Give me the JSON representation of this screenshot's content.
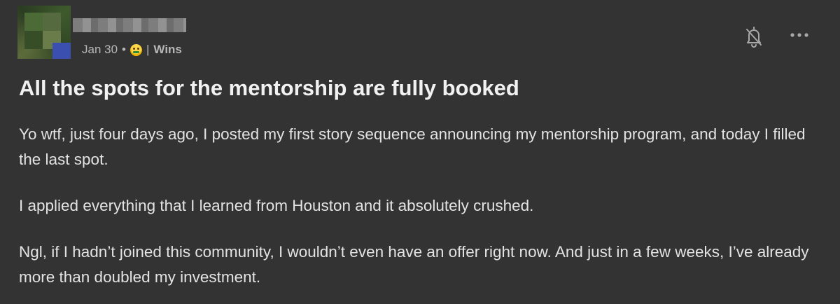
{
  "post": {
    "date": "Jan 30",
    "separator": "•",
    "emoji_icon": "money-mouth-face-emoji-icon",
    "category_prefix": "|",
    "category": "Wins",
    "title": "All the spots for the mentorship are fully booked",
    "paragraphs": [
      "Yo wtf, just four days ago, I posted my first story sequence announcing my mentorship program, and today I filled the last spot.",
      "I applied everything that I learned from Houston and it absolutely crushed.",
      "Ngl, if I hadn’t joined this community, I wouldn’t even have an offer right now. And just in a few weeks, I’ve already more than doubled my investment."
    ]
  },
  "actions": {
    "notifications_icon": "bell-off-icon",
    "more_icon": "more-horizontal-icon"
  },
  "colors": {
    "background": "#333333",
    "title": "#f1f1f1",
    "body_text": "#e3e3e3",
    "meta_text": "#b7b7b7"
  }
}
